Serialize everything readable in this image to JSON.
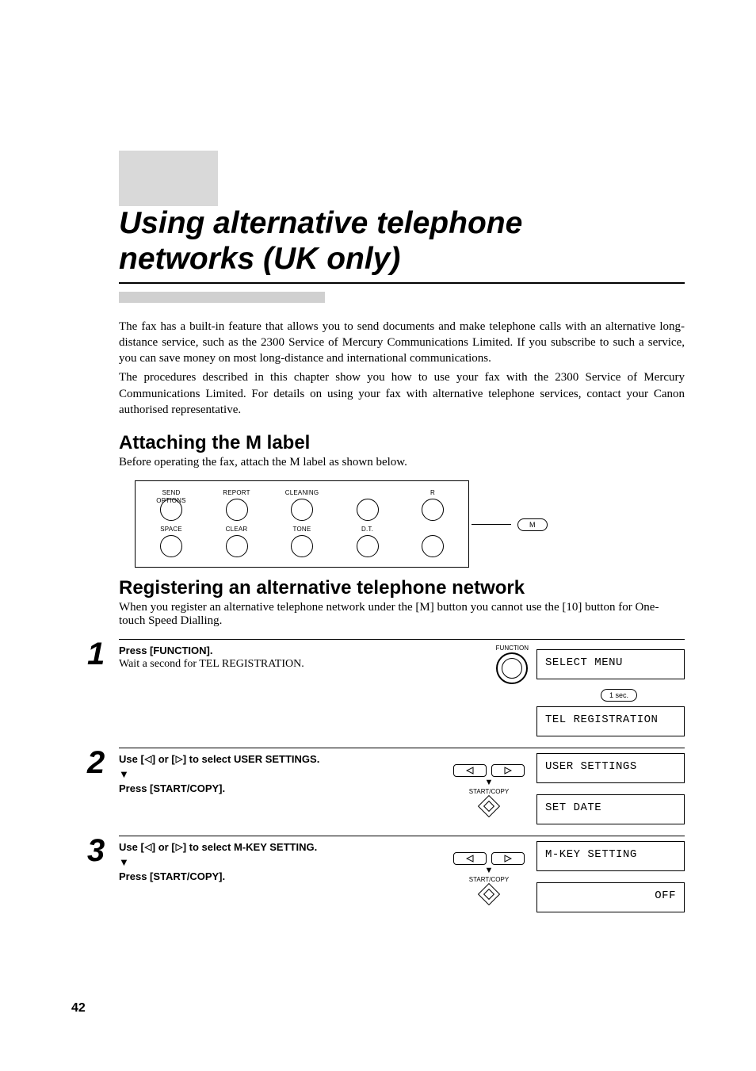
{
  "title_line1": "Using alternative telephone",
  "title_line2": "networks (UK only)",
  "intro_p1": "The fax has a built-in feature that allows you to send documents and make telephone calls with an alternative long-distance service, such as the 2300 Service of Mercury Communications Limited. If you subscribe to such a service, you can save money on most long-distance and international communications.",
  "intro_p2": "The procedures described in this chapter show you how to use your fax with the 2300 Service of Mercury Communications Limited. For details on using your fax with alternative telephone services, contact your Canon authorised representative.",
  "h2_attach": "Attaching the M label",
  "attach_sub": "Before operating the fax, attach the M label as shown below.",
  "panel": {
    "row1": [
      "SEND OPTIONS",
      "REPORT",
      "CLEANING",
      "",
      "R"
    ],
    "row2": [
      "SPACE",
      "CLEAR",
      "TONE",
      "D.T.",
      ""
    ],
    "m_label": "M"
  },
  "h2_register": "Registering an alternative telephone network",
  "register_sub": "When you register an alternative telephone network under the [M] button you cannot use the [10] button for One-touch Speed Dialling.",
  "steps": {
    "1": {
      "bold": "Press [FUNCTION].",
      "plain": "Wait a second for TEL REGISTRATION.",
      "func_label": "FUNCTION",
      "lcd1": "SELECT MENU",
      "pill": "1 sec.",
      "lcd2": "TEL REGISTRATION"
    },
    "2": {
      "bold_a": "Use [",
      "bold_b": "] or [",
      "bold_c": "] to select USER SETTINGS.",
      "bold2": "Press [START/COPY].",
      "nav_label": "START/COPY",
      "lcd1": "USER SETTINGS",
      "lcd2": "SET DATE"
    },
    "3": {
      "bold_a": "Use [",
      "bold_b": "] or [",
      "bold_c": "] to select M-KEY SETTING.",
      "bold2": "Press [START/COPY].",
      "nav_label": "START/COPY",
      "lcd1": "M-KEY SETTING",
      "lcd2": "OFF"
    }
  },
  "page_number": "42"
}
